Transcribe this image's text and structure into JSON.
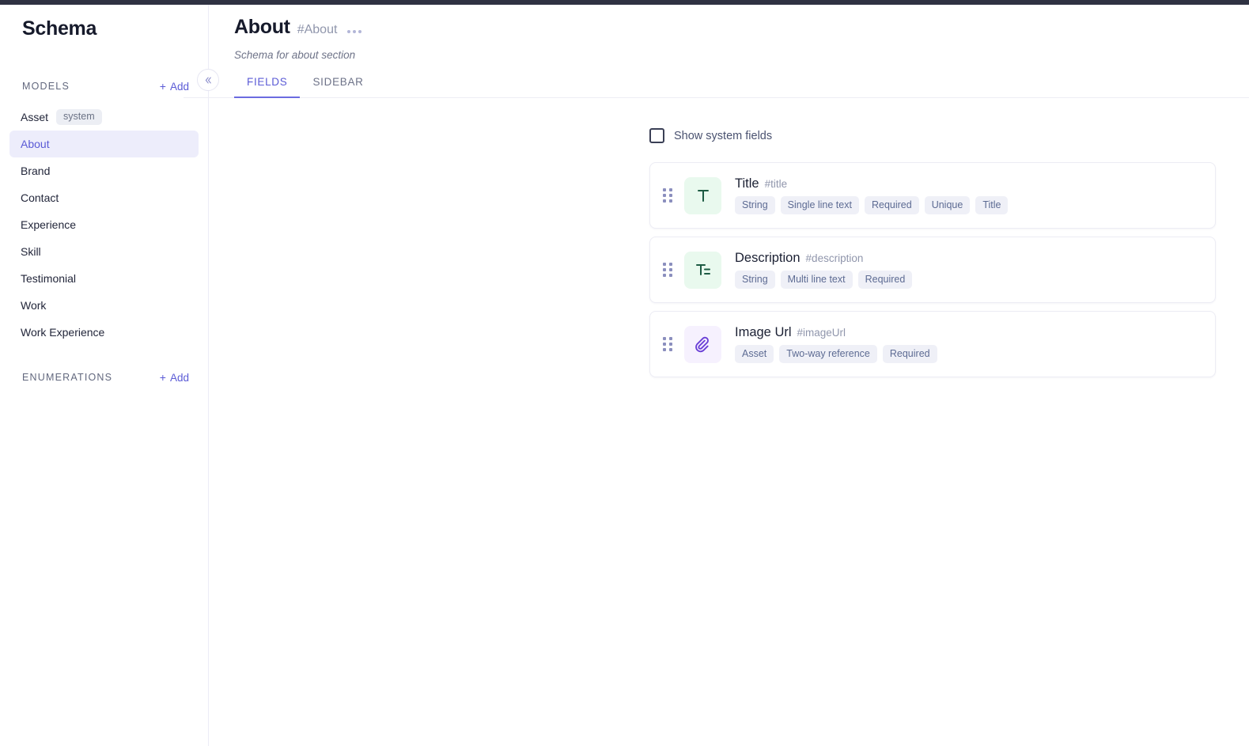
{
  "topbar": {
    "color": "#2f3242"
  },
  "sidebar": {
    "title": "Schema",
    "models_section": {
      "label": "MODELS",
      "add_label": "Add",
      "add_icon": "plus-icon"
    },
    "models": [
      {
        "label": "Asset",
        "badge": "system",
        "active": false
      },
      {
        "label": "About",
        "badge": "",
        "active": true
      },
      {
        "label": "Brand",
        "badge": "",
        "active": false
      },
      {
        "label": "Contact",
        "badge": "",
        "active": false
      },
      {
        "label": "Experience",
        "badge": "",
        "active": false
      },
      {
        "label": "Skill",
        "badge": "",
        "active": false
      },
      {
        "label": "Testimonial",
        "badge": "",
        "active": false
      },
      {
        "label": "Work",
        "badge": "",
        "active": false
      },
      {
        "label": "Work Experience",
        "badge": "",
        "active": false
      }
    ],
    "enumerations_section": {
      "label": "ENUMERATIONS",
      "add_label": "Add",
      "add_icon": "plus-icon"
    },
    "collapse_icon": "chevron-double-left-icon"
  },
  "header": {
    "title": "About",
    "slug": "#About",
    "menu_icon": "ellipsis-horizontal-icon",
    "description": "Schema for about section"
  },
  "tabs": [
    {
      "label": "FIELDS",
      "active": true
    },
    {
      "label": "SIDEBAR",
      "active": false
    }
  ],
  "content": {
    "show_system_fields": {
      "label": "Show system fields",
      "checked": false
    },
    "fields": [
      {
        "name": "Title",
        "slug": "#title",
        "icon": "text-single-line-icon",
        "icon_theme": "green",
        "tags": [
          "String",
          "Single line text",
          "Required",
          "Unique",
          "Title"
        ]
      },
      {
        "name": "Description",
        "slug": "#description",
        "icon": "text-multi-line-icon",
        "icon_theme": "green",
        "tags": [
          "String",
          "Multi line text",
          "Required"
        ]
      },
      {
        "name": "Image Url",
        "slug": "#imageUrl",
        "icon": "paperclip-icon",
        "icon_theme": "purple",
        "tags": [
          "Asset",
          "Two-way reference",
          "Required"
        ]
      }
    ]
  },
  "colors": {
    "accent": "#5b5bd6",
    "active_bg": "#ededfb",
    "tag_bg": "#eff0f7",
    "tag_text": "#5d6b93",
    "icon_green_bg": "#e9f9ee",
    "icon_green_fg": "#1d5b43",
    "icon_purple_bg": "#f6f1fe",
    "icon_purple_fg": "#6a3fd6"
  }
}
